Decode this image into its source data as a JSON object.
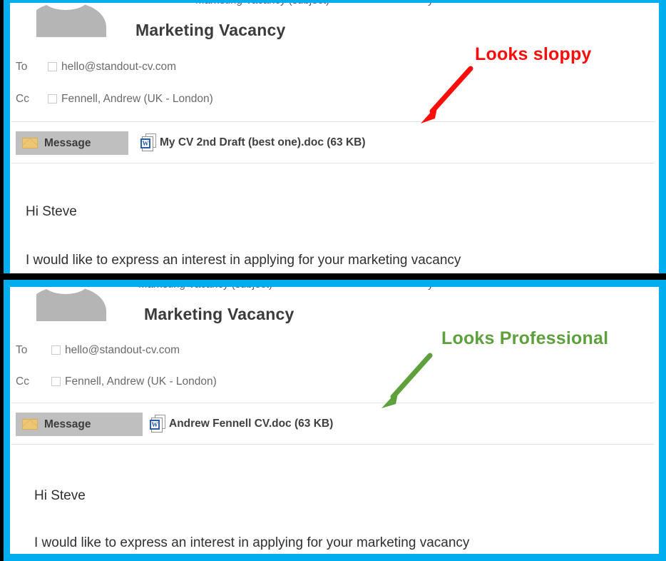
{
  "meta": {
    "frame_color": "#00ADEE",
    "divider_color": "#000000"
  },
  "annotations": [
    {
      "id": "sloppy",
      "label": "Looks sloppy",
      "color": "#FB0D0C",
      "arrow_direction": "down-left"
    },
    {
      "id": "professional",
      "label": "Looks Professional",
      "color": "#5DA03C",
      "arrow_direction": "down-left"
    }
  ],
  "panels": [
    {
      "id": "sloppy-example",
      "clipped_top_text": ". . ,",
      "avatar": "person-silhouette-avatar",
      "subject": "Marketing Vacancy",
      "fields": [
        {
          "label": "To",
          "value": "hello@standout-cv.com",
          "checkbox": true
        },
        {
          "label": "Cc",
          "value": "Fennell, Andrew (UK - London)",
          "checkbox": true
        }
      ],
      "message_tab": {
        "label": "Message",
        "icon": "envelope-icon",
        "background": "#BFBFBF",
        "icon_color": "#EDC673"
      },
      "attachment": {
        "icon": "word-document-icon",
        "name": "My CV 2nd Draft (best one).doc (63 KB)",
        "filename": "My CV 2nd Draft (best one).doc",
        "size": "63 KB"
      },
      "body": [
        "Hi Steve",
        "I would like to express an interest in applying for your marketing vacancy"
      ]
    },
    {
      "id": "professional-example",
      "clipped_top_text": ". . ,",
      "avatar": "person-silhouette-avatar",
      "subject": "Marketing Vacancy",
      "fields": [
        {
          "label": "To",
          "value": "hello@standout-cv.com",
          "checkbox": true
        },
        {
          "label": "Cc",
          "value": "Fennell, Andrew (UK - London)",
          "checkbox": true
        }
      ],
      "message_tab": {
        "label": "Message",
        "icon": "envelope-icon",
        "background": "#BFBFBF",
        "icon_color": "#EDC673"
      },
      "attachment": {
        "icon": "word-document-icon",
        "name": "Andrew Fennell CV.doc (63 KB)",
        "filename": "Andrew Fennell CV.doc",
        "size": "63 KB"
      },
      "body": [
        "Hi Steve",
        "I would like to express an interest in applying for your marketing vacancy"
      ]
    }
  ]
}
